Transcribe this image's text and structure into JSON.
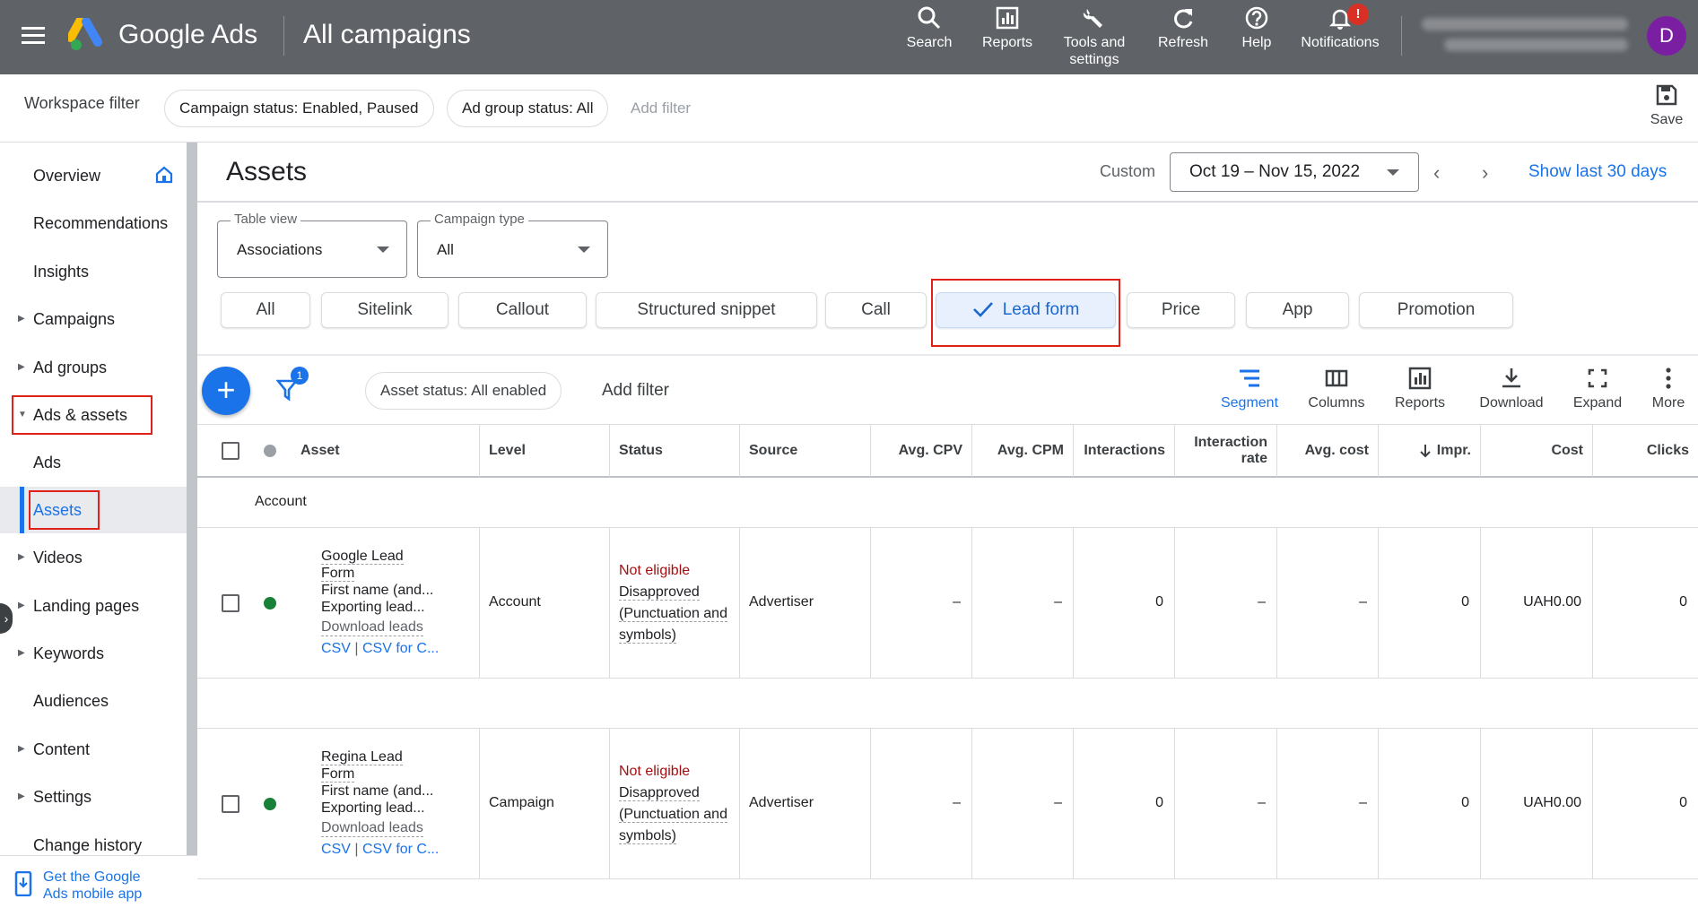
{
  "header": {
    "brand": "Google Ads",
    "page_title": "All campaigns",
    "tools": [
      {
        "label": "Search",
        "icon": "search-icon"
      },
      {
        "label": "Reports",
        "icon": "bar-chart-icon"
      },
      {
        "label": "Tools and settings",
        "icon": "wrench-icon"
      },
      {
        "label": "Refresh",
        "icon": "refresh-icon"
      },
      {
        "label": "Help",
        "icon": "help-icon"
      },
      {
        "label": "Notifications",
        "icon": "bell-icon"
      }
    ],
    "notifications_badge": "!",
    "avatar_initial": "D"
  },
  "filter_bar": {
    "label": "Workspace filter",
    "chips": [
      "Campaign status: Enabled, Paused",
      "Ad group status: All"
    ],
    "add_filter": "Add filter",
    "save_label": "Save"
  },
  "sidebar": {
    "items": [
      {
        "label": "Overview",
        "expandable": false
      },
      {
        "label": "Recommendations",
        "expandable": false
      },
      {
        "label": "Insights",
        "expandable": false
      },
      {
        "label": "Campaigns",
        "expandable": true
      },
      {
        "label": "Ad groups",
        "expandable": true
      },
      {
        "label": "Ads & assets",
        "expandable": true,
        "expanded": true
      },
      {
        "label": "Ads",
        "expandable": false
      },
      {
        "label": "Assets",
        "expandable": false,
        "active": true
      },
      {
        "label": "Videos",
        "expandable": true
      },
      {
        "label": "Landing pages",
        "expandable": true
      },
      {
        "label": "Keywords",
        "expandable": true
      },
      {
        "label": "Audiences",
        "expandable": false
      },
      {
        "label": "Content",
        "expandable": true
      },
      {
        "label": "Settings",
        "expandable": true
      },
      {
        "label": "Change history",
        "expandable": false
      }
    ],
    "mobile_app_line1": "Get the Google",
    "mobile_app_line2": "Ads mobile app"
  },
  "main": {
    "title": "Assets",
    "date_label": "Custom",
    "date_range": "Oct 19 – Nov 15, 2022",
    "show_last": "Show last 30 days",
    "table_view": {
      "legend": "Table view",
      "value": "Associations"
    },
    "campaign_type": {
      "legend": "Campaign type",
      "value": "All"
    },
    "type_chips": [
      "All",
      "Sitelink",
      "Callout",
      "Structured snippet",
      "Call",
      "Lead form",
      "Price",
      "App",
      "Promotion"
    ],
    "selected_type": "Lead form",
    "filter_count": "1",
    "asset_status_chip": "Asset status: All enabled",
    "add_filter": "Add filter",
    "toolbar": [
      "Segment",
      "Columns",
      "Reports",
      "Download",
      "Expand",
      "More"
    ]
  },
  "table": {
    "columns": [
      "Asset",
      "Level",
      "Status",
      "Source",
      "Avg. CPV",
      "Avg. CPM",
      "Interactions",
      "Interaction rate",
      "Avg. cost",
      "Impr.",
      "Cost",
      "Clicks"
    ],
    "sort_column": "Impr.",
    "group_label": "Account",
    "rows": [
      {
        "asset_name": "Google Lead Form",
        "asset_line1": "First name (and...",
        "asset_line2": "Exporting lead...",
        "download": "Download leads",
        "link1": "CSV",
        "link_sep": "|",
        "link2": "CSV for C...",
        "level": "Account",
        "status_main": "Not eligible",
        "status_detail": "Disapproved (Punctuation and symbols)",
        "source": "Advertiser",
        "avg_cpv": "–",
        "avg_cpm": "–",
        "interactions": "0",
        "interaction_rate": "–",
        "avg_cost": "–",
        "impr": "0",
        "cost": "UAH0.00",
        "clicks": "0"
      },
      {
        "asset_name": "Regina Lead Form",
        "asset_line1": "First name (and...",
        "asset_line2": "Exporting lead...",
        "download": "Download leads",
        "link1": "CSV",
        "link_sep": "|",
        "link2": "CSV for C...",
        "level": "Campaign",
        "status_main": "Not eligible",
        "status_detail": "Disapproved (Punctuation and symbols)",
        "source": "Advertiser",
        "avg_cpv": "–",
        "avg_cpm": "–",
        "interactions": "0",
        "interaction_rate": "–",
        "avg_cost": "–",
        "impr": "0",
        "cost": "UAH0.00",
        "clicks": "0"
      }
    ]
  },
  "colors": {
    "topbar": "#5f6368",
    "accent": "#1a73e8",
    "highlight": "#e0201b",
    "enabled_dot": "#188038",
    "avatar": "#7b1fa2"
  }
}
